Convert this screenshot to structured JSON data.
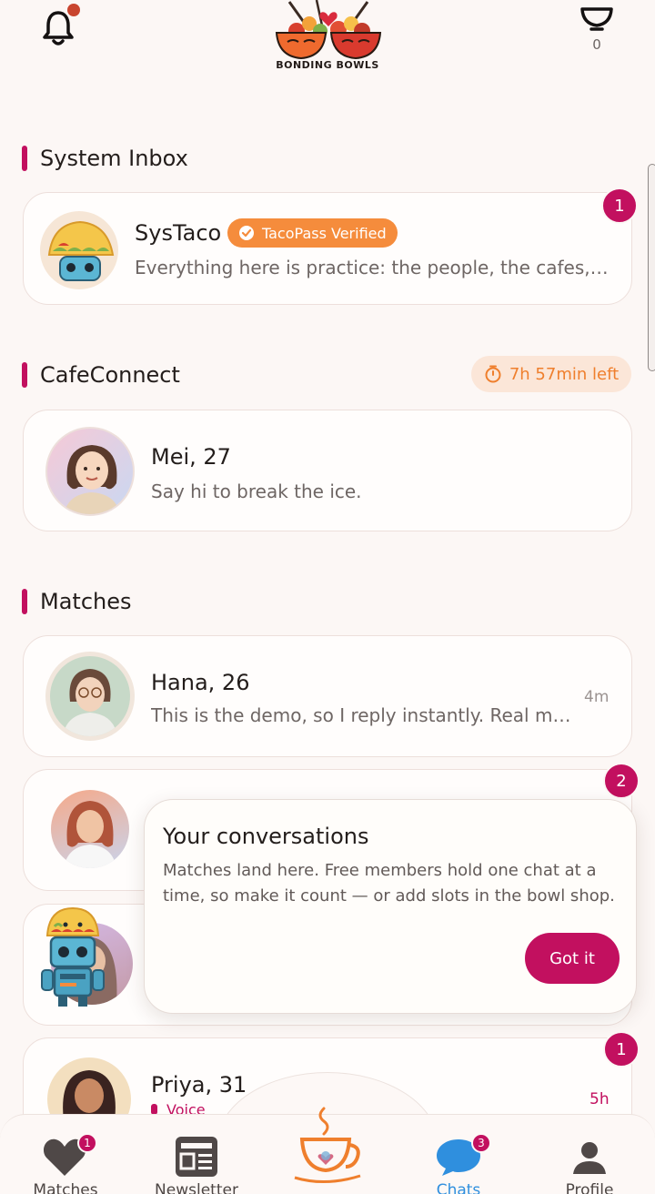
{
  "header": {
    "logo_text": "BONDING BOWLS",
    "bowl_count": "0"
  },
  "system_inbox": {
    "title": "System Inbox",
    "card": {
      "name": "SysTaco",
      "verified_label": "TacoPass Verified",
      "preview": "Everything here is practice: the people, the cafes, and the conversations.",
      "unread": "1"
    }
  },
  "cafe_connect": {
    "title": "CafeConnect",
    "timer": "7h 57min left",
    "card": {
      "name": "Mei, 27",
      "preview": "Say hi to break the ice."
    }
  },
  "matches": {
    "title": "Matches",
    "items": [
      {
        "name": "Hana, 26",
        "preview": "This is the demo, so I reply instantly. Real matches take longer.",
        "time": "4m"
      },
      {
        "unread": "2"
      },
      {},
      {
        "name": "Priya, 31",
        "preview": "Voice",
        "time": "5h",
        "unread": "1"
      }
    ]
  },
  "tooltip": {
    "title": "Your conversations",
    "body": "Matches land here. Free members hold one chat at a time, so make it count — or add slots in the bowl shop.",
    "button": "Got it"
  },
  "nav": {
    "matches": {
      "label": "Matches",
      "badge": "1"
    },
    "newsletter": {
      "label": "Newsletter"
    },
    "chats": {
      "label": "Chats",
      "badge": "3"
    },
    "profile": {
      "label": "Profile"
    }
  },
  "colors": {
    "accent": "#c2105f",
    "orange": "#f58c3c",
    "chat_blue": "#2f8fde",
    "background": "#fcf7f5"
  },
  "icons": [
    "bell-icon",
    "bowl-icon",
    "heart-icon",
    "newspaper-icon",
    "coffee-cup-icon",
    "chat-bubble-icon",
    "person-icon",
    "timer-icon",
    "check-badge-icon"
  ]
}
